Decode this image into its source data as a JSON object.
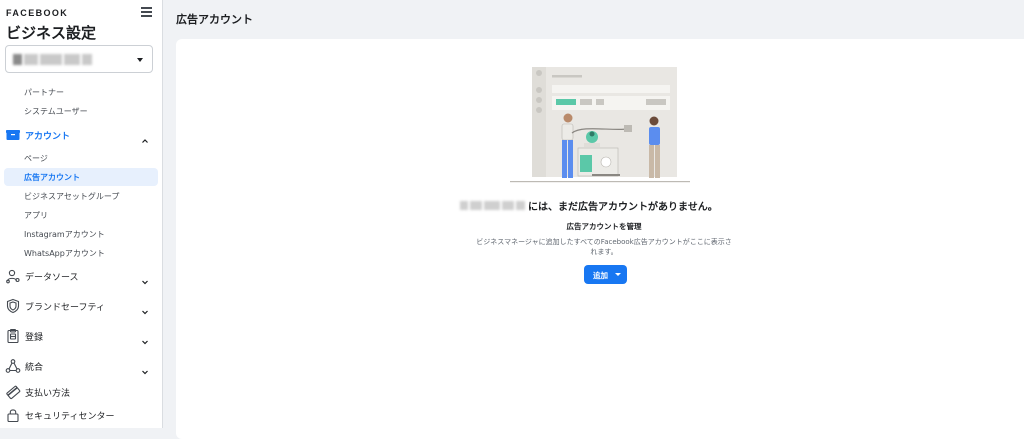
{
  "sidebar": {
    "brand": "FACEBOOK",
    "title": "ビジネス設定",
    "business_selector_value": "",
    "users_items": [
      {
        "label": "パートナー"
      },
      {
        "label": "システムユーザー"
      }
    ],
    "accounts_section": {
      "label": "アカウント",
      "icon": "briefcase-icon",
      "items": [
        {
          "label": "ページ"
        },
        {
          "label": "広告アカウント",
          "active": true
        },
        {
          "label": "ビジネスアセットグループ"
        },
        {
          "label": "アプリ"
        },
        {
          "label": "Instagramアカウント"
        },
        {
          "label": "WhatsAppアカウント"
        }
      ]
    },
    "sections": [
      {
        "label": "データソース",
        "icon": "people-network-icon"
      },
      {
        "label": "ブランドセーフティ",
        "icon": "shield-icon"
      },
      {
        "label": "登録",
        "icon": "clipboard-icon"
      },
      {
        "label": "統合",
        "icon": "integration-icon"
      }
    ],
    "bottom_items": [
      {
        "label": "支払い方法",
        "icon": "credit-card-icon"
      },
      {
        "label": "セキュリティセンター",
        "icon": "lock-icon"
      }
    ]
  },
  "main": {
    "header": "広告アカウント",
    "empty_state": {
      "title_suffix": "には、まだ広告アカウントがありません。",
      "subtitle": "広告アカウントを管理",
      "description_line1": "ビジネスマネージャに追加したすべてのFacebook広告アカウントがここに表示さ",
      "description_line2": "れます。",
      "add_button": "追加"
    }
  },
  "colors": {
    "accent": "#1877f2",
    "active_bg": "#e7f0fd",
    "page_bg": "#f0f2f5"
  }
}
